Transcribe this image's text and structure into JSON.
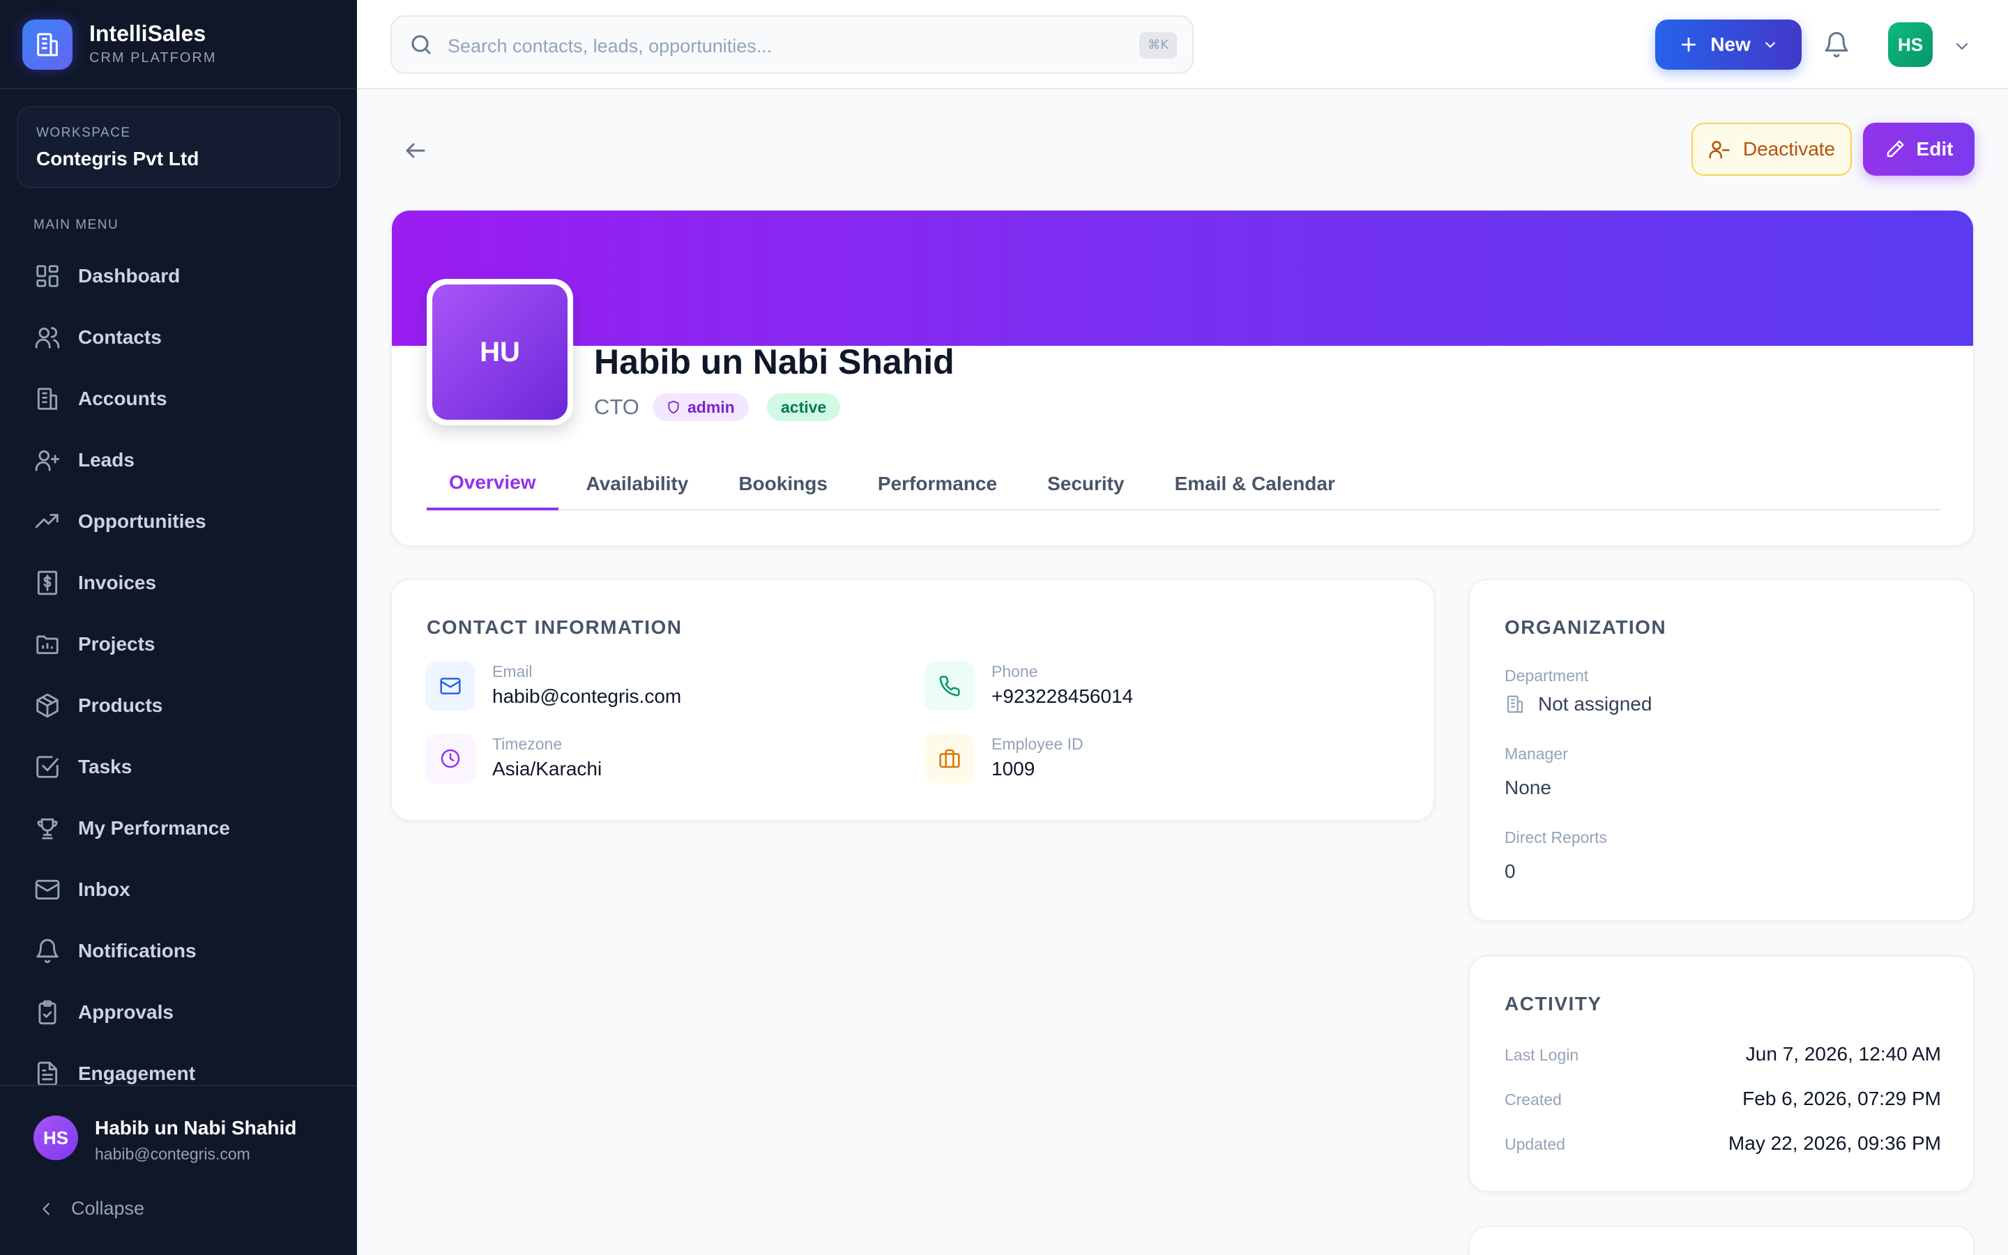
{
  "brand": {
    "name": "IntelliSales",
    "subtitle": "CRM PLATFORM"
  },
  "workspace": {
    "label": "WORKSPACE",
    "name": "Contegris Pvt Ltd"
  },
  "sidebar": {
    "menu_label": "MAIN MENU",
    "items": [
      {
        "label": "Dashboard",
        "icon": "dashboard-icon"
      },
      {
        "label": "Contacts",
        "icon": "users-icon"
      },
      {
        "label": "Accounts",
        "icon": "building-icon"
      },
      {
        "label": "Leads",
        "icon": "user-plus-icon"
      },
      {
        "label": "Opportunities",
        "icon": "trending-up-icon"
      },
      {
        "label": "Invoices",
        "icon": "receipt-icon"
      },
      {
        "label": "Projects",
        "icon": "folder-icon"
      },
      {
        "label": "Products",
        "icon": "package-icon"
      },
      {
        "label": "Tasks",
        "icon": "check-square-icon"
      },
      {
        "label": "My Performance",
        "icon": "trophy-icon"
      },
      {
        "label": "Inbox",
        "icon": "mail-icon"
      },
      {
        "label": "Notifications",
        "icon": "bell-icon"
      },
      {
        "label": "Approvals",
        "icon": "clipboard-check-icon"
      },
      {
        "label": "Engagement",
        "icon": "file-text-icon"
      }
    ],
    "user": {
      "initials": "HS",
      "name": "Habib un Nabi Shahid",
      "email": "habib@contegris.com"
    },
    "collapse_label": "Collapse"
  },
  "topbar": {
    "search_placeholder": "Search contacts, leads, opportunities...",
    "shortcut": "⌘K",
    "new_label": "New",
    "avatar_initials": "HS"
  },
  "actions": {
    "deactivate_label": "Deactivate",
    "edit_label": "Edit"
  },
  "profile": {
    "initials": "HU",
    "name": "Habib un Nabi Shahid",
    "title": "CTO",
    "role_badge": "admin",
    "status_badge": "active",
    "tabs": [
      "Overview",
      "Availability",
      "Bookings",
      "Performance",
      "Security",
      "Email & Calendar"
    ],
    "active_tab": 0
  },
  "contact": {
    "title": "CONTACT INFORMATION",
    "email_label": "Email",
    "email": "habib@contegris.com",
    "phone_label": "Phone",
    "phone": "+923228456014",
    "timezone_label": "Timezone",
    "timezone": "Asia/Karachi",
    "employee_id_label": "Employee ID",
    "employee_id": "1009"
  },
  "organization": {
    "title": "ORGANIZATION",
    "department_label": "Department",
    "department": "Not assigned",
    "manager_label": "Manager",
    "manager": "None",
    "direct_reports_label": "Direct Reports",
    "direct_reports": "0"
  },
  "activity": {
    "title": "ACTIVITY",
    "last_login_label": "Last Login",
    "last_login": "Jun 7, 2026, 12:40 AM",
    "created_label": "Created",
    "created": "Feb 6, 2026, 07:29 PM",
    "updated_label": "Updated",
    "updated": "May 22, 2026, 09:36 PM"
  },
  "colors": {
    "sidebar_bg": "#0f1729",
    "accent_purple": "#9333ea",
    "primary_blue": "#2563eb",
    "success_green": "#10b981",
    "warning_amber": "#b45309"
  }
}
